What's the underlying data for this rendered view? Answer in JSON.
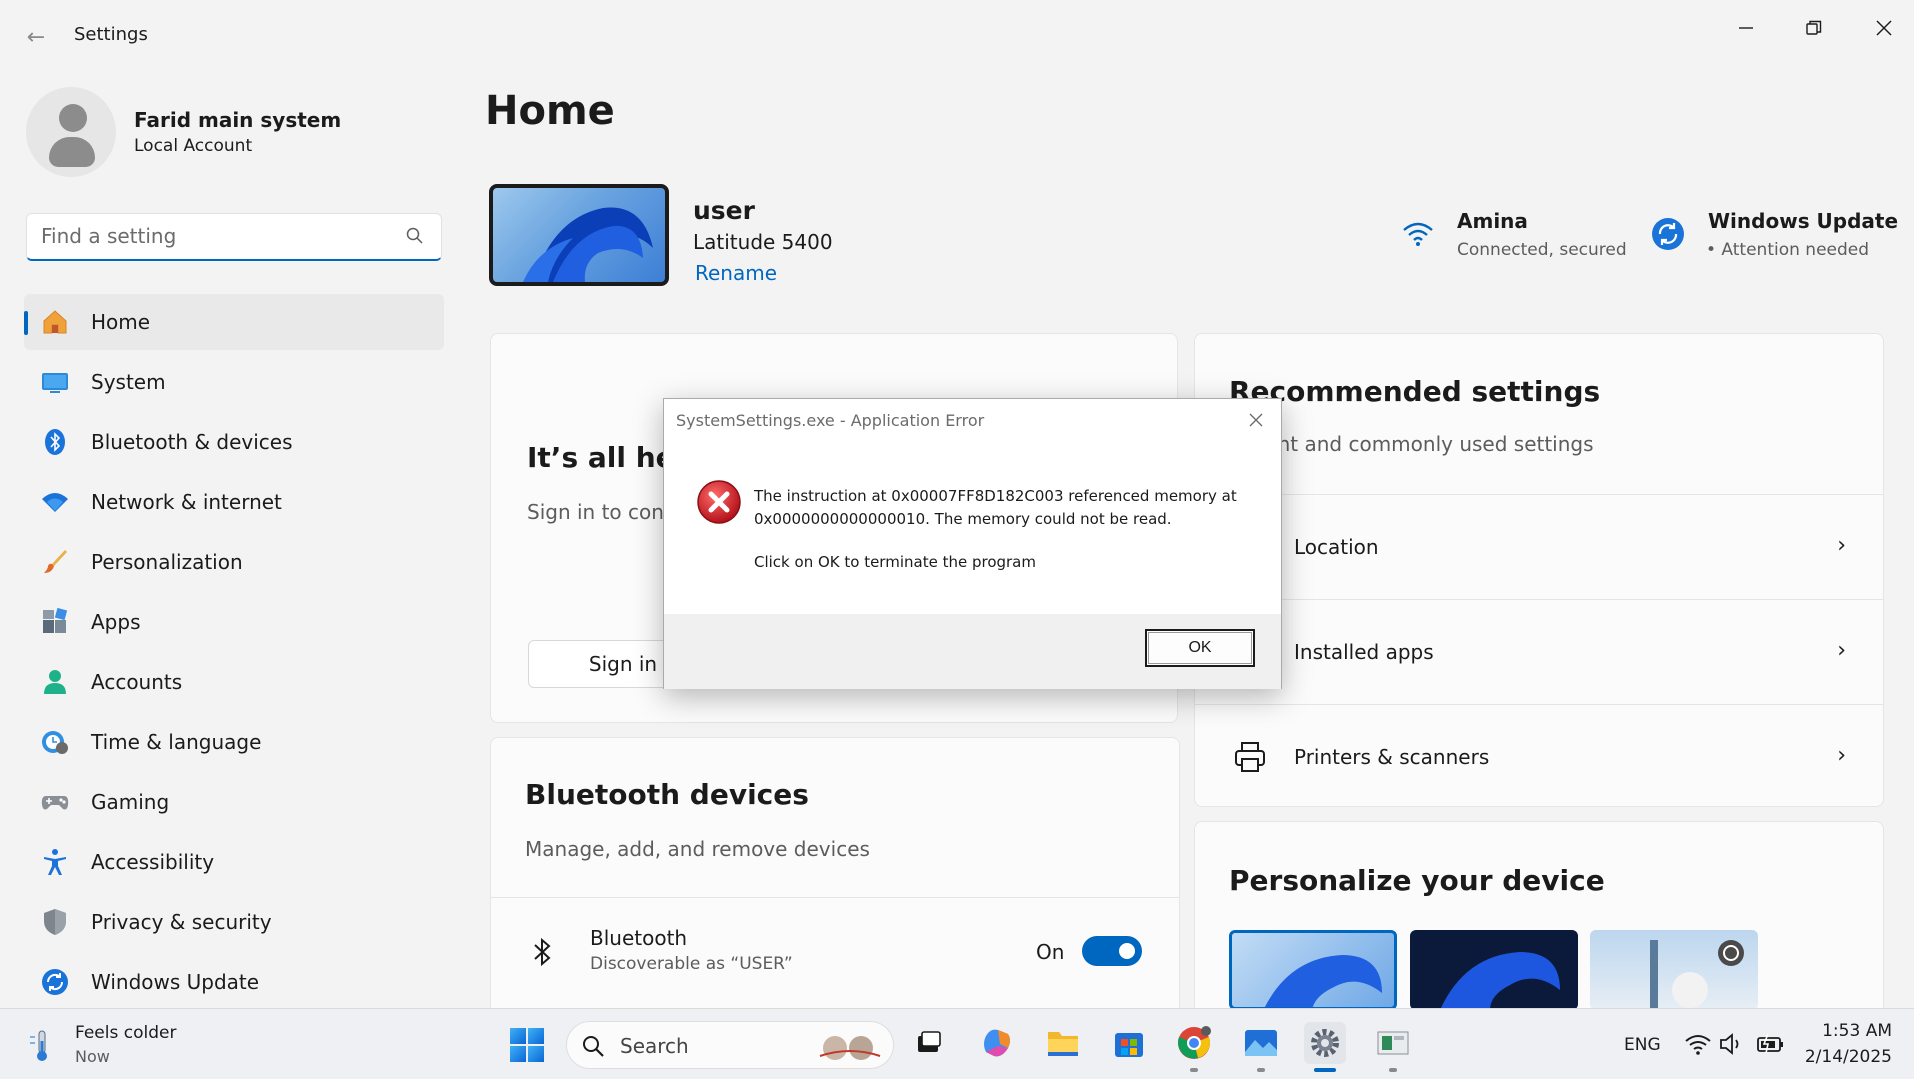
{
  "window": {
    "title": "Settings",
    "back_icon": "arrow-left-icon",
    "controls": [
      "minimize-icon",
      "restore-icon",
      "close-icon"
    ]
  },
  "profile": {
    "name": "Farid main system",
    "account_type": "Local Account"
  },
  "search": {
    "placeholder": "Find a setting"
  },
  "sidebar": {
    "items": [
      {
        "label": "Home",
        "icon": "home-icon",
        "active": true
      },
      {
        "label": "System",
        "icon": "system-icon"
      },
      {
        "label": "Bluetooth & devices",
        "icon": "bluetooth-icon"
      },
      {
        "label": "Network & internet",
        "icon": "wifi-icon"
      },
      {
        "label": "Personalization",
        "icon": "brush-icon"
      },
      {
        "label": "Apps",
        "icon": "apps-icon"
      },
      {
        "label": "Accounts",
        "icon": "accounts-icon"
      },
      {
        "label": "Time & language",
        "icon": "clock-globe-icon"
      },
      {
        "label": "Gaming",
        "icon": "gamepad-icon"
      },
      {
        "label": "Accessibility",
        "icon": "accessibility-icon"
      },
      {
        "label": "Privacy & security",
        "icon": "shield-icon"
      },
      {
        "label": "Windows Update",
        "icon": "update-icon"
      }
    ]
  },
  "main": {
    "title": "Home",
    "device": {
      "name": "user",
      "model": "Latitude 5400",
      "rename_label": "Rename"
    },
    "network_status": {
      "title": "Amina",
      "subtitle": "Connected, secured"
    },
    "update_status": {
      "title": "Windows Update",
      "subtitle": "• Attention needed"
    },
    "microsoft_card": {
      "title": "It’s all here",
      "subtitle": "Sign in to connect",
      "button": "Sign in"
    },
    "recommended": {
      "title": "Recommended settings",
      "subtitle": "Recent and commonly used settings",
      "items": [
        {
          "label": "Location",
          "icon": "location-icon"
        },
        {
          "label": "Installed apps",
          "icon": "apps-list-icon"
        },
        {
          "label": "Printers & scanners",
          "icon": "printer-icon"
        }
      ]
    },
    "bluetooth_card": {
      "title": "Bluetooth devices",
      "subtitle": "Manage, add, and remove devices",
      "row_title": "Bluetooth",
      "row_subtitle": "Discoverable as “USER”",
      "toggle_label": "On",
      "toggle_on": true
    },
    "personalize": {
      "title": "Personalize your device"
    }
  },
  "dialog": {
    "title": "SystemSettings.exe - Application Error",
    "message_line1": "The instruction at 0x00007FF8D182C003 referenced memory at",
    "message_line2": "0x0000000000000010. The memory could not be read.",
    "message_action": "Click on OK to terminate the program",
    "ok_label": "OK",
    "icon": "error-icon"
  },
  "taskbar": {
    "weather_title": "Feels colder",
    "weather_sub": "Now",
    "search_label": "Search",
    "apps": [
      "start-icon",
      "task-view-icon",
      "copilot-icon",
      "file-explorer-icon",
      "store-icon",
      "chrome-icon",
      "photos-icon",
      "settings-icon",
      "app-icon"
    ],
    "language": "ENG",
    "time": "1:53 AM",
    "date": "2/14/2025"
  },
  "colors": {
    "accent": "#0067c0",
    "error": "#d32f2f",
    "background": "#f3f3f3"
  }
}
